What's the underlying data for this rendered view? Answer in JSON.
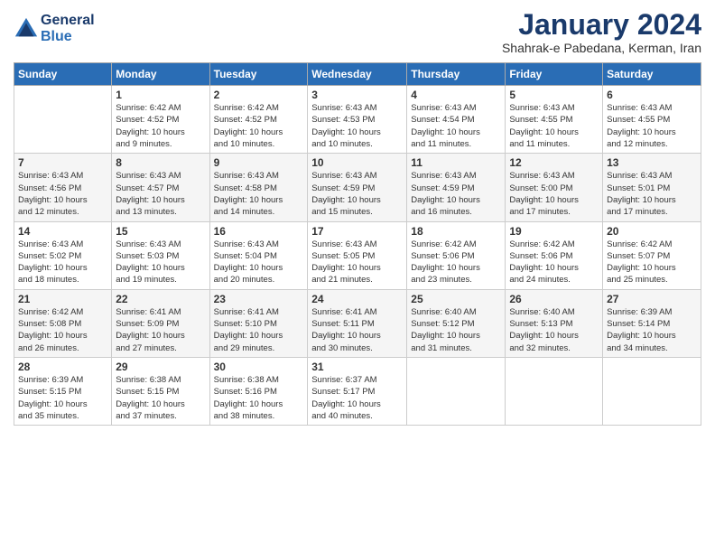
{
  "logo": {
    "line1": "General",
    "line2": "Blue"
  },
  "title": "January 2024",
  "subtitle": "Shahrak-e Pabedana, Kerman, Iran",
  "days_of_week": [
    "Sunday",
    "Monday",
    "Tuesday",
    "Wednesday",
    "Thursday",
    "Friday",
    "Saturday"
  ],
  "weeks": [
    [
      {
        "day": "",
        "info": ""
      },
      {
        "day": "1",
        "info": "Sunrise: 6:42 AM\nSunset: 4:52 PM\nDaylight: 10 hours\nand 9 minutes."
      },
      {
        "day": "2",
        "info": "Sunrise: 6:42 AM\nSunset: 4:52 PM\nDaylight: 10 hours\nand 10 minutes."
      },
      {
        "day": "3",
        "info": "Sunrise: 6:43 AM\nSunset: 4:53 PM\nDaylight: 10 hours\nand 10 minutes."
      },
      {
        "day": "4",
        "info": "Sunrise: 6:43 AM\nSunset: 4:54 PM\nDaylight: 10 hours\nand 11 minutes."
      },
      {
        "day": "5",
        "info": "Sunrise: 6:43 AM\nSunset: 4:55 PM\nDaylight: 10 hours\nand 11 minutes."
      },
      {
        "day": "6",
        "info": "Sunrise: 6:43 AM\nSunset: 4:55 PM\nDaylight: 10 hours\nand 12 minutes."
      }
    ],
    [
      {
        "day": "7",
        "info": "Sunrise: 6:43 AM\nSunset: 4:56 PM\nDaylight: 10 hours\nand 12 minutes."
      },
      {
        "day": "8",
        "info": "Sunrise: 6:43 AM\nSunset: 4:57 PM\nDaylight: 10 hours\nand 13 minutes."
      },
      {
        "day": "9",
        "info": "Sunrise: 6:43 AM\nSunset: 4:58 PM\nDaylight: 10 hours\nand 14 minutes."
      },
      {
        "day": "10",
        "info": "Sunrise: 6:43 AM\nSunset: 4:59 PM\nDaylight: 10 hours\nand 15 minutes."
      },
      {
        "day": "11",
        "info": "Sunrise: 6:43 AM\nSunset: 4:59 PM\nDaylight: 10 hours\nand 16 minutes."
      },
      {
        "day": "12",
        "info": "Sunrise: 6:43 AM\nSunset: 5:00 PM\nDaylight: 10 hours\nand 17 minutes."
      },
      {
        "day": "13",
        "info": "Sunrise: 6:43 AM\nSunset: 5:01 PM\nDaylight: 10 hours\nand 17 minutes."
      }
    ],
    [
      {
        "day": "14",
        "info": "Sunrise: 6:43 AM\nSunset: 5:02 PM\nDaylight: 10 hours\nand 18 minutes."
      },
      {
        "day": "15",
        "info": "Sunrise: 6:43 AM\nSunset: 5:03 PM\nDaylight: 10 hours\nand 19 minutes."
      },
      {
        "day": "16",
        "info": "Sunrise: 6:43 AM\nSunset: 5:04 PM\nDaylight: 10 hours\nand 20 minutes."
      },
      {
        "day": "17",
        "info": "Sunrise: 6:43 AM\nSunset: 5:05 PM\nDaylight: 10 hours\nand 21 minutes."
      },
      {
        "day": "18",
        "info": "Sunrise: 6:42 AM\nSunset: 5:06 PM\nDaylight: 10 hours\nand 23 minutes."
      },
      {
        "day": "19",
        "info": "Sunrise: 6:42 AM\nSunset: 5:06 PM\nDaylight: 10 hours\nand 24 minutes."
      },
      {
        "day": "20",
        "info": "Sunrise: 6:42 AM\nSunset: 5:07 PM\nDaylight: 10 hours\nand 25 minutes."
      }
    ],
    [
      {
        "day": "21",
        "info": "Sunrise: 6:42 AM\nSunset: 5:08 PM\nDaylight: 10 hours\nand 26 minutes."
      },
      {
        "day": "22",
        "info": "Sunrise: 6:41 AM\nSunset: 5:09 PM\nDaylight: 10 hours\nand 27 minutes."
      },
      {
        "day": "23",
        "info": "Sunrise: 6:41 AM\nSunset: 5:10 PM\nDaylight: 10 hours\nand 29 minutes."
      },
      {
        "day": "24",
        "info": "Sunrise: 6:41 AM\nSunset: 5:11 PM\nDaylight: 10 hours\nand 30 minutes."
      },
      {
        "day": "25",
        "info": "Sunrise: 6:40 AM\nSunset: 5:12 PM\nDaylight: 10 hours\nand 31 minutes."
      },
      {
        "day": "26",
        "info": "Sunrise: 6:40 AM\nSunset: 5:13 PM\nDaylight: 10 hours\nand 32 minutes."
      },
      {
        "day": "27",
        "info": "Sunrise: 6:39 AM\nSunset: 5:14 PM\nDaylight: 10 hours\nand 34 minutes."
      }
    ],
    [
      {
        "day": "28",
        "info": "Sunrise: 6:39 AM\nSunset: 5:15 PM\nDaylight: 10 hours\nand 35 minutes."
      },
      {
        "day": "29",
        "info": "Sunrise: 6:38 AM\nSunset: 5:15 PM\nDaylight: 10 hours\nand 37 minutes."
      },
      {
        "day": "30",
        "info": "Sunrise: 6:38 AM\nSunset: 5:16 PM\nDaylight: 10 hours\nand 38 minutes."
      },
      {
        "day": "31",
        "info": "Sunrise: 6:37 AM\nSunset: 5:17 PM\nDaylight: 10 hours\nand 40 minutes."
      },
      {
        "day": "",
        "info": ""
      },
      {
        "day": "",
        "info": ""
      },
      {
        "day": "",
        "info": ""
      }
    ]
  ]
}
